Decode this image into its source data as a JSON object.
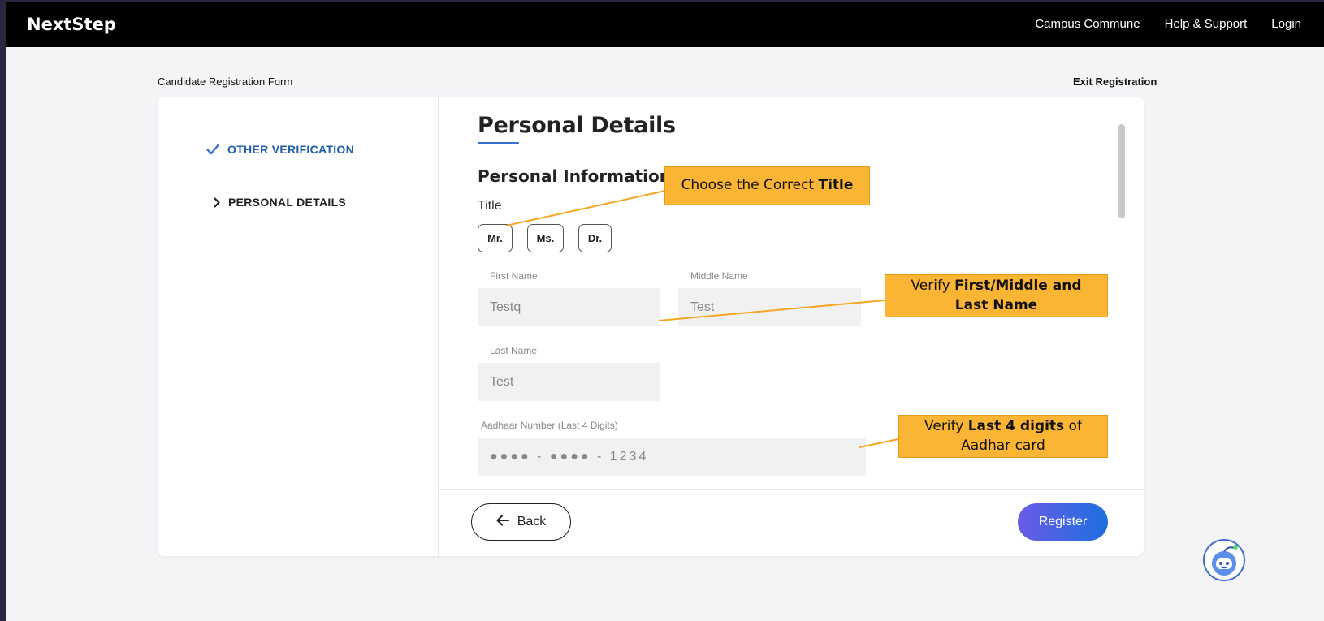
{
  "header": {
    "brand": "NextStep",
    "nav": [
      "Campus Commune",
      "Help & Support",
      "Login"
    ]
  },
  "page": {
    "form_title": "Candidate Registration Form",
    "exit_label": "Exit Registration"
  },
  "sidebar": {
    "items": [
      {
        "label": "OTHER VERIFICATION",
        "state": "completed",
        "icon": "check-icon"
      },
      {
        "label": "PERSONAL DETAILS",
        "state": "current",
        "icon": "chevron-right-icon"
      }
    ]
  },
  "form": {
    "heading": "Personal Details",
    "subheading": "Personal Information",
    "title_label": "Title",
    "title_options": [
      "Mr.",
      "Ms.",
      "Dr."
    ],
    "first_name_label": "First Name",
    "first_name_value": "Testq",
    "middle_name_label": "Middle Name",
    "middle_name_value": "Test",
    "last_name_label": "Last Name",
    "last_name_value": "Test",
    "aadhaar_label": "Aadhaar Number (Last 4 Digits)",
    "aadhaar_masked": "●●●● - ●●●● - 1234"
  },
  "footer": {
    "back_label": "Back",
    "register_label": "Register"
  },
  "callouts": {
    "title_prefix": "Choose the Correct",
    "title_bold": "Title",
    "name_prefix": "Verify",
    "name_bold_1": "First/Middle and",
    "name_bold_2": "Last Name",
    "aadhaar_prefix": "Verify",
    "aadhaar_bold": "Last 4 digits",
    "aadhaar_suffix": "of",
    "aadhaar_line2": "Aadhar card"
  },
  "colors": {
    "accent": "#1f5ea8",
    "callout": "#fbb534",
    "register_gradient_start": "#6a5be6",
    "register_gradient_end": "#1d6fe0"
  }
}
